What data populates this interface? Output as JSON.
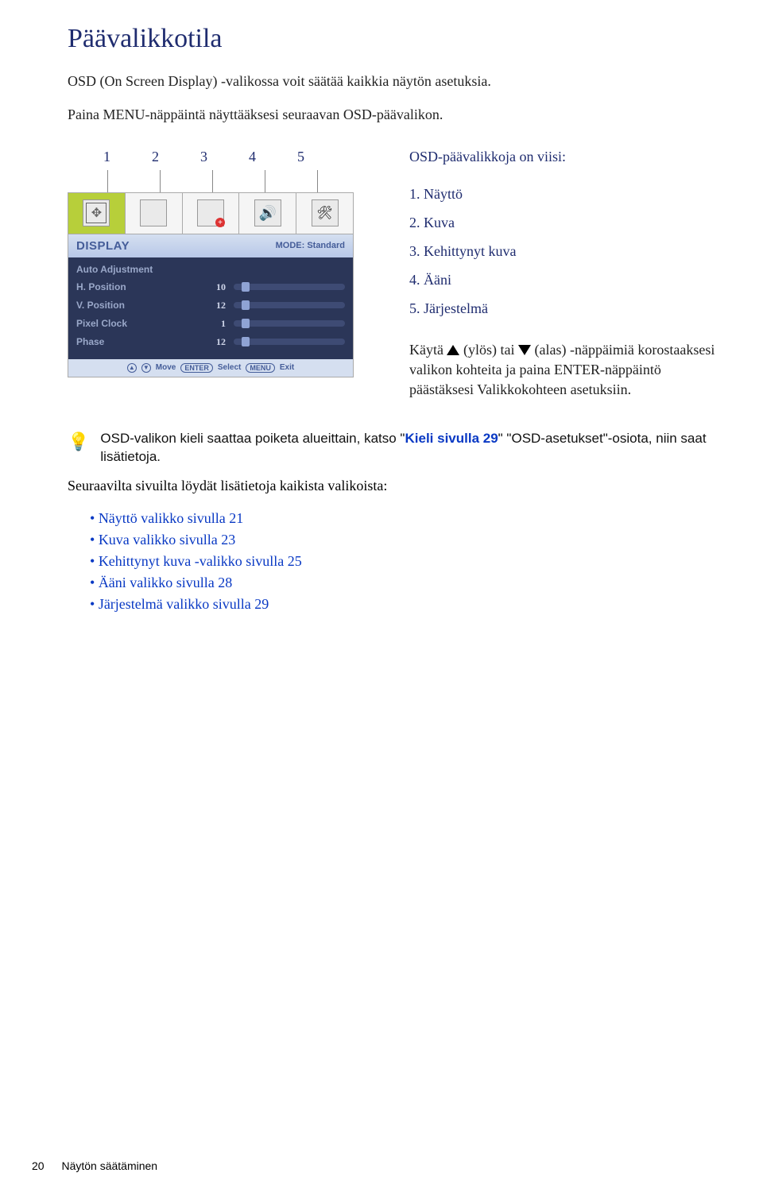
{
  "page": {
    "title": "Päävalikkotila",
    "intro": "OSD (On Screen Display) -valikossa voit säätää kaikkia näytön asetuksia.",
    "instruction_pre": "Paina ",
    "instruction_bold": "MENU",
    "instruction_post": "-näppäintä näyttääksesi seuraavan OSD-päävalikon."
  },
  "callouts": {
    "n1": "1",
    "n2": "2",
    "n3": "3",
    "n4": "4",
    "n5": "5"
  },
  "osd": {
    "header_left": "DISPLAY",
    "header_right": "MODE: Standard",
    "rows": {
      "auto": "Auto Adjustment",
      "hpos": "H. Position",
      "hpos_val": "10",
      "vpos": "V. Position",
      "vpos_val": "12",
      "pclk": "Pixel Clock",
      "pclk_val": "1",
      "phase": "Phase",
      "phase_val": "12"
    },
    "footer": {
      "move": "Move",
      "enter": "ENTER",
      "select": "Select",
      "menu": "MENU",
      "exit": "Exit",
      "up": "▲",
      "down": "▼"
    }
  },
  "right": {
    "heading": "OSD-päävalikkoja on viisi:",
    "items": {
      "i1": "1. Näyttö",
      "i2": "2. Kuva",
      "i3": "3. Kehittynyt kuva",
      "i4": "4. Ääni",
      "i5": "5. Järjestelmä"
    },
    "usage_1": "Käytä ",
    "usage_2": " (ylös) tai ",
    "usage_3": " (alas) -näppäimiä korostaaksesi valikon kohteita ja paina ",
    "usage_enter": "ENTER",
    "usage_4": "-näppäintö päästäksesi Valikkokohteen asetuksiin."
  },
  "note": {
    "pre": "OSD-valikon kieli saattaa poiketa alueittain, katso \"",
    "link": "Kieli sivulla 29",
    "post": "\" \"OSD-asetukset\"-osiota, niin saat lisätietoja."
  },
  "after_note": "Seuraavilta sivuilta löydät lisätietoja kaikista valikoista:",
  "links": {
    "l1": "Näyttö valikko sivulla 21",
    "l2": "Kuva valikko sivulla 23",
    "l3": "Kehittynyt kuva -valikko sivulla 25",
    "l4": "Ääni valikko sivulla 28",
    "l5": "Järjestelmä valikko sivulla 29"
  },
  "footer": {
    "page_num": "20",
    "section": "Näytön säätäminen"
  }
}
